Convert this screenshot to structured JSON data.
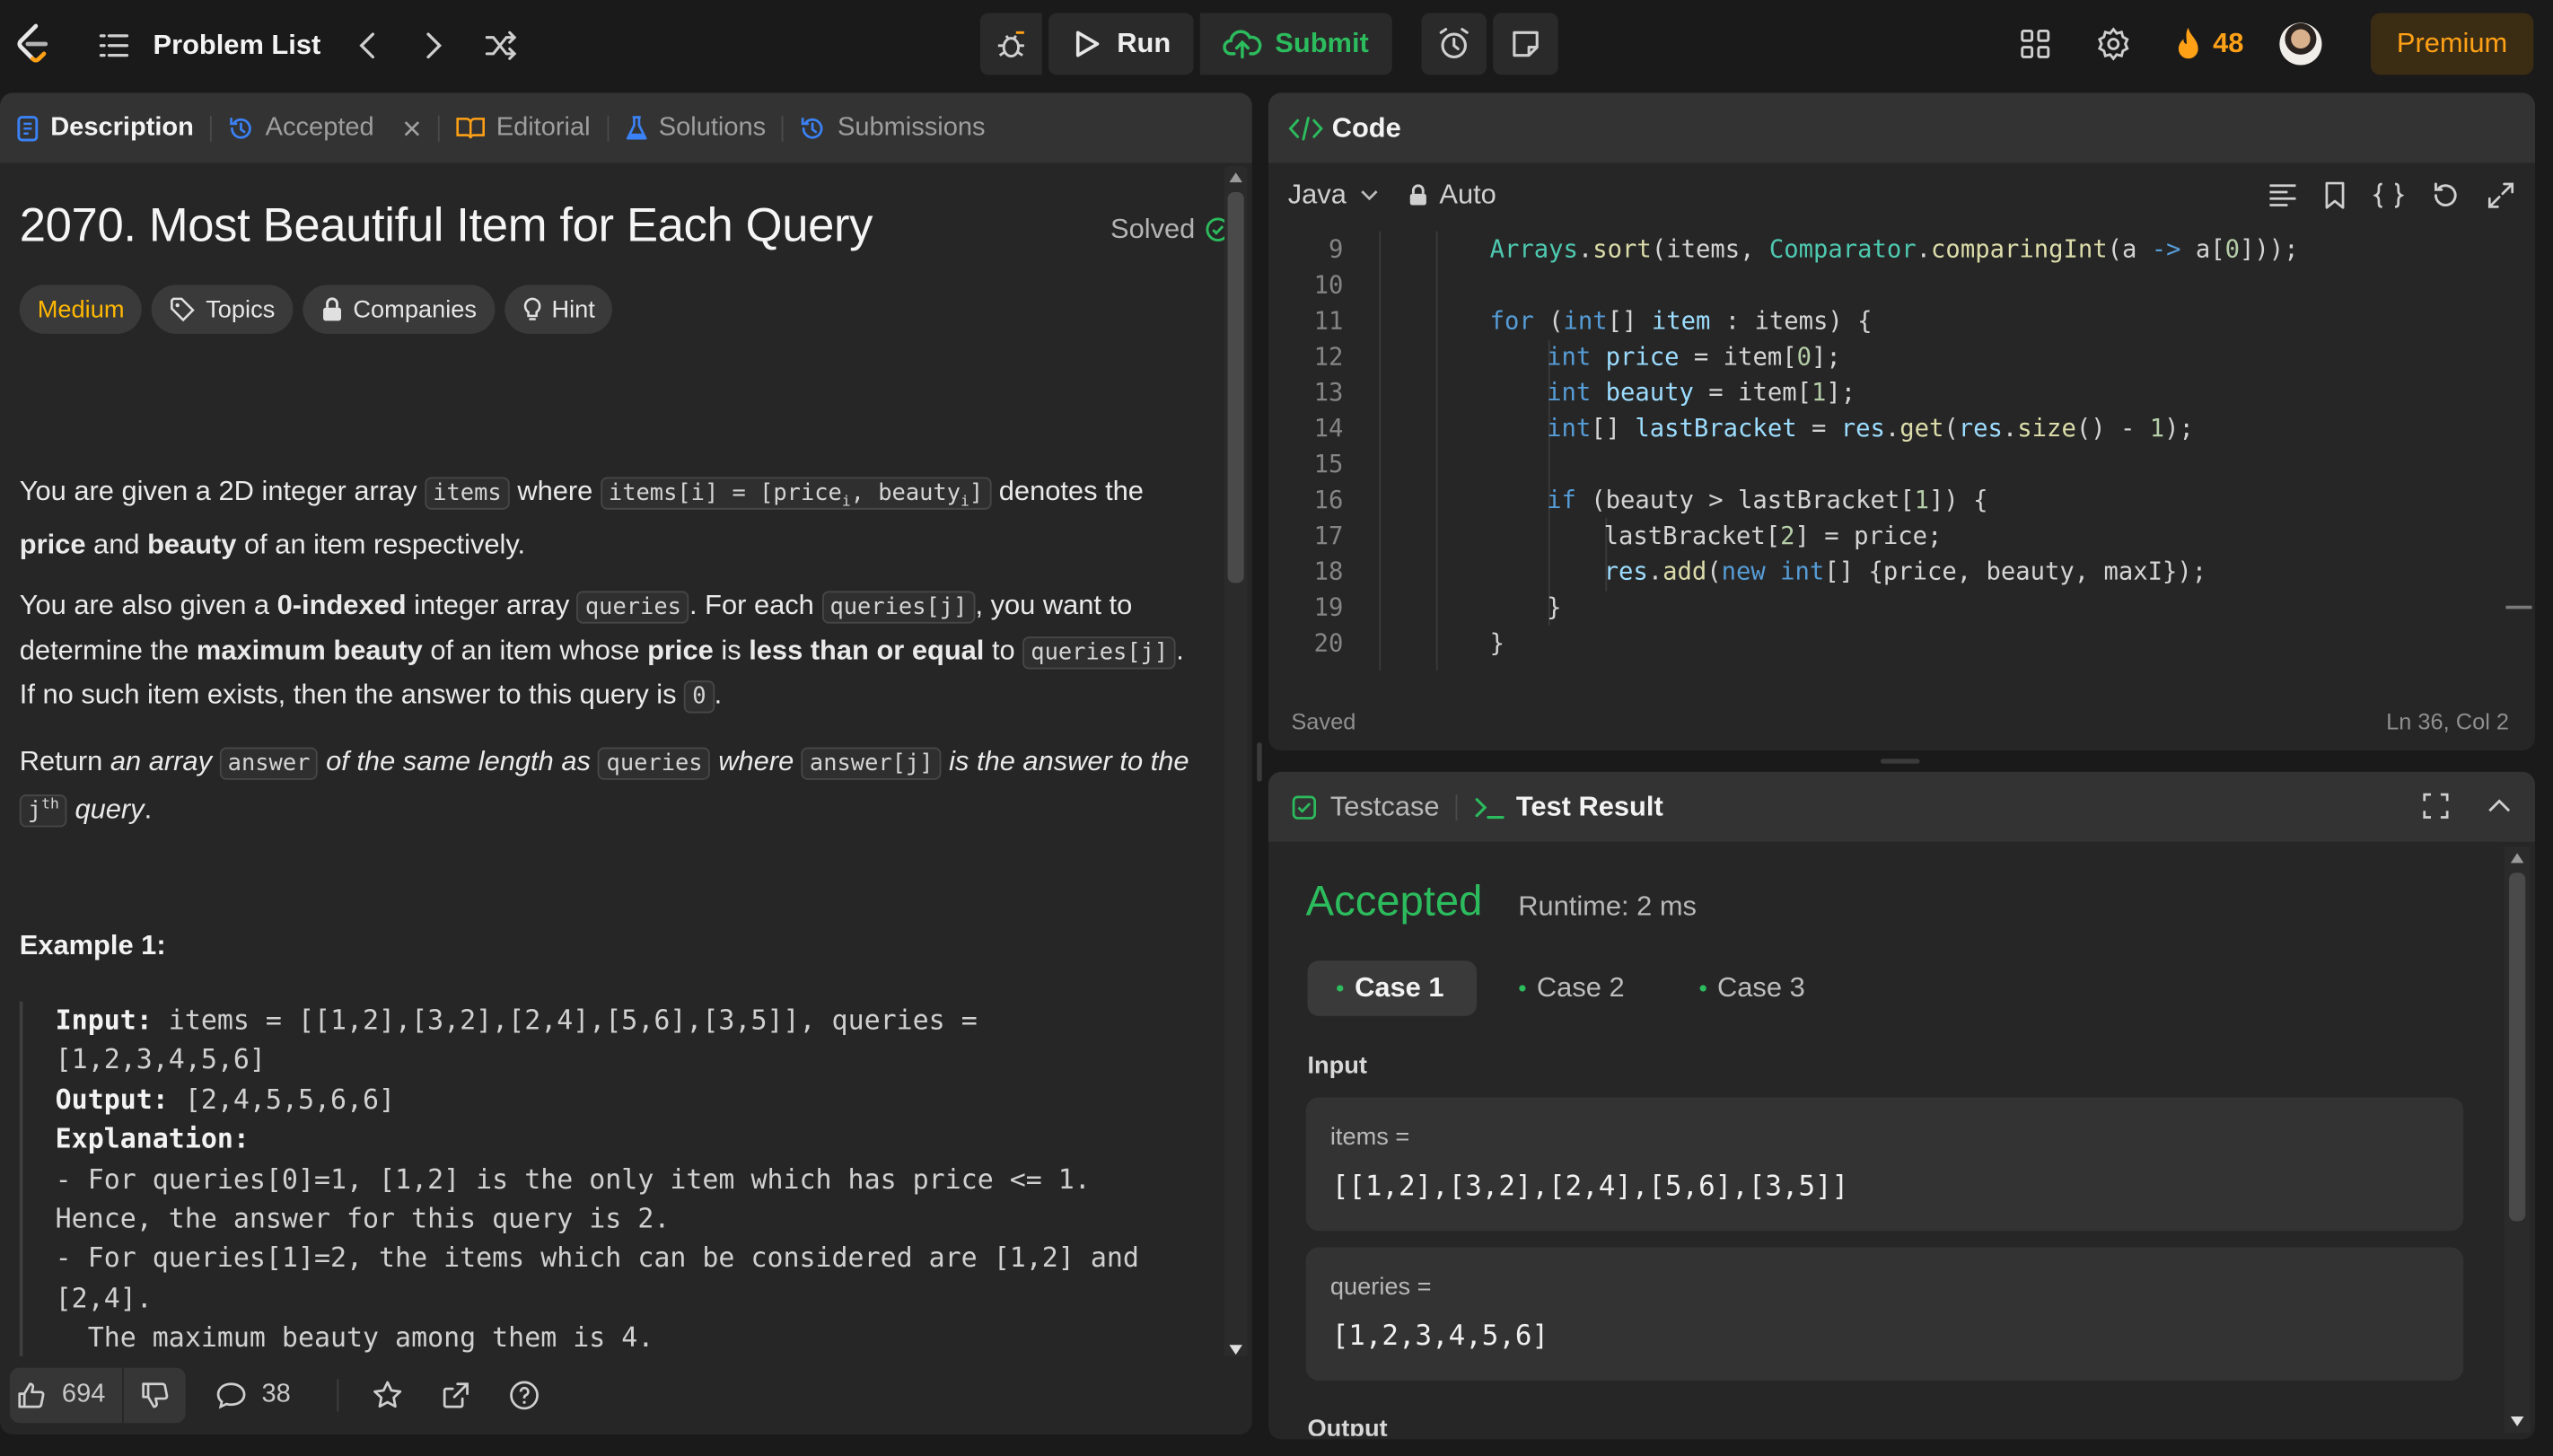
{
  "nav": {
    "problem_list": "Problem List",
    "run": "Run",
    "submit": "Submit",
    "streak": "48",
    "premium": "Premium"
  },
  "desc_tabs": {
    "description": "Description",
    "accepted": "Accepted",
    "editorial": "Editorial",
    "solutions": "Solutions",
    "submissions": "Submissions"
  },
  "problem": {
    "title": "2070. Most Beautiful Item for Each Query",
    "solved": "Solved",
    "difficulty": "Medium",
    "chips": [
      "Topics",
      "Companies",
      "Hint"
    ],
    "example_title": "Example 1:"
  },
  "footer": {
    "likes": "694",
    "comments": "38"
  },
  "code_panel": {
    "title": "Code",
    "language": "Java",
    "mode": "Auto",
    "status": "Saved",
    "cursor": "Ln 36, Col 2",
    "line_numbers": [
      "9",
      "10",
      "11",
      "12",
      "13",
      "14",
      "15",
      "16",
      "17",
      "18",
      "19",
      "20"
    ]
  },
  "result_panel": {
    "testcase_tab": "Testcase",
    "result_tab": "Test Result",
    "verdict": "Accepted",
    "runtime": "Runtime: 2 ms",
    "cases": [
      "Case 1",
      "Case 2",
      "Case 3"
    ],
    "input_label": "Input",
    "items_label": "items =",
    "items_value": "[[1,2],[3,2],[2,4],[5,6],[3,5]]",
    "queries_label": "queries =",
    "queries_value": "[1,2,3,4,5,6]",
    "output_label": "Output"
  },
  "colors": {
    "accent_orange": "#ffa116",
    "accepted_green": "#2cbb5d",
    "medium_yellow": "#ffb800"
  }
}
